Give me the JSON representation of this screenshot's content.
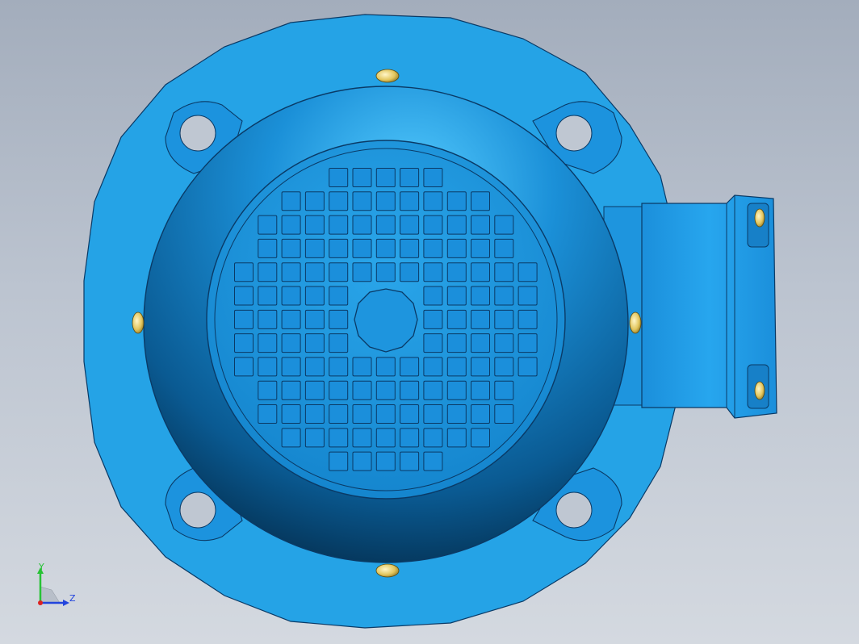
{
  "viewport": {
    "background_top": "#a3adbc",
    "background_bottom": "#d4d9e0"
  },
  "model": {
    "flange_color": "#25a3e6",
    "body_color": "#1a8fd6",
    "body_dark": "#04304f",
    "highlight": "#4fc6f7",
    "outline": "#0a3a66",
    "bolt_color": "#e8d06a",
    "fan_grille": {
      "rows": 13,
      "cols": 13
    }
  },
  "triad": {
    "y_label": "Y",
    "z_label": "Z",
    "y_color": "#27c235",
    "z_color": "#2244dd",
    "x_color": "#dd2222"
  }
}
